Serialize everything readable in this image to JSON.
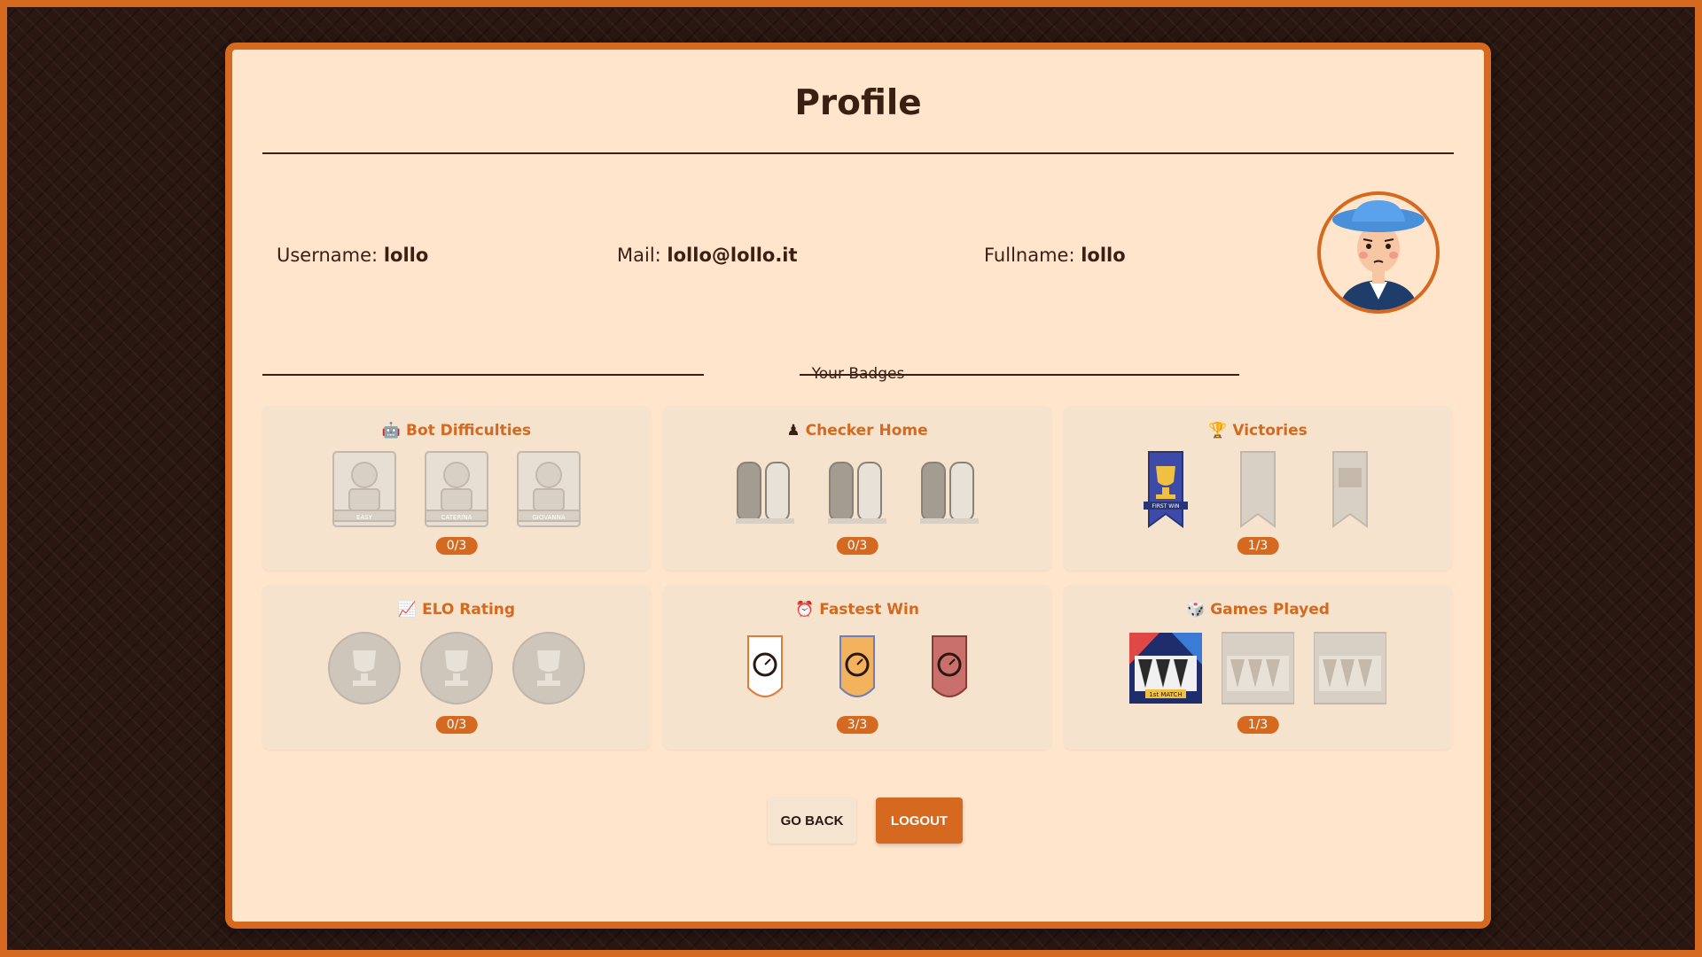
{
  "page": {
    "title": "Profile"
  },
  "user": {
    "username_label": "Username:",
    "username": "lollo",
    "mail_label": "Mail:",
    "mail": "lollo@lollo.it",
    "fullname_label": "Fullname:",
    "fullname": "lollo"
  },
  "badges_section": {
    "label": "Your Badges"
  },
  "badge_groups": [
    {
      "icon": "robot-face-icon",
      "emoji": "🤖",
      "title": "Bot Difficulties",
      "progress": "0/3",
      "earned": [
        false,
        false,
        false
      ],
      "badge_labels": [
        "EASY",
        "CATERINA",
        "GIOVANNA"
      ]
    },
    {
      "icon": "pawn-icon",
      "emoji": "♟",
      "title": "Checker Home",
      "progress": "0/3",
      "earned": [
        false,
        false,
        false
      ],
      "badge_labels": [
        "",
        "",
        ""
      ]
    },
    {
      "icon": "trophy-icon",
      "emoji": "🏆",
      "title": "Victories",
      "progress": "1/3",
      "earned": [
        true,
        false,
        false
      ],
      "badge_labels": [
        "FIRST WIN",
        "",
        ""
      ]
    },
    {
      "icon": "chart-increasing-icon",
      "emoji": "📈",
      "title": "ELO Rating",
      "progress": "0/3",
      "earned": [
        false,
        false,
        false
      ],
      "badge_labels": [
        "",
        "",
        ""
      ]
    },
    {
      "icon": "alarm-clock-icon",
      "emoji": "⏰",
      "title": "Fastest Win",
      "progress": "3/3",
      "earned": [
        true,
        true,
        true
      ],
      "badge_labels": [
        "",
        "",
        ""
      ]
    },
    {
      "icon": "die-icon",
      "emoji": "🎲",
      "title": "Games Played",
      "progress": "1/3",
      "earned": [
        true,
        false,
        false
      ],
      "badge_labels": [
        "1st MATCH",
        "",
        ""
      ]
    }
  ],
  "buttons": {
    "go_back": "GO BACK",
    "logout": "LOGOUT"
  },
  "colors": {
    "accent": "#d4691f",
    "card_bg": "#ffe5cc",
    "tile_bg": "#f5e3cd",
    "text": "#3a2013"
  }
}
